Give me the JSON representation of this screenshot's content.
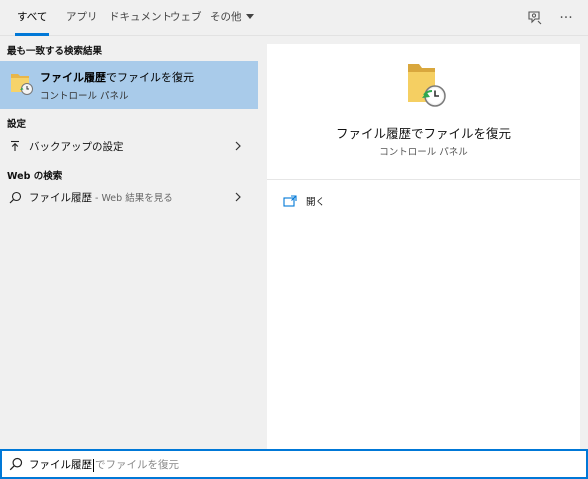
{
  "tabs": [
    {
      "label": "すべて",
      "active": true
    },
    {
      "label": "アプリ",
      "active": false
    },
    {
      "label": "ドキュメント",
      "active": false
    },
    {
      "label": "ウェブ",
      "active": false
    },
    {
      "label": "その他",
      "active": false
    }
  ],
  "topbar": {
    "feedback_icon": "feedback-icon",
    "more_icon": "more-icon",
    "more_glyph": "···"
  },
  "results": {
    "best_match_header": "最も一致する検索結果",
    "best_match": {
      "title_bold": "ファイル履歴",
      "title_rest": "でファイルを復元",
      "subtitle": "コントロール パネル",
      "icon": "file-history-folder-icon"
    },
    "settings_header": "設定",
    "settings_item": {
      "label": "バックアップの設定",
      "icon": "backup-arrow-icon"
    },
    "web_header": "Web の検索",
    "web_item": {
      "label": "ファイル履歴",
      "suffix": " - Web 結果を見る",
      "icon": "search-icon"
    }
  },
  "preview": {
    "title": "ファイル履歴でファイルを復元",
    "subtitle": "コントロール パネル",
    "actions": [
      {
        "label": "開く",
        "icon": "open-window-icon"
      }
    ]
  },
  "search": {
    "typed": "ファイル履歴",
    "suggestion": "でファイルを復元"
  },
  "colors": {
    "accent": "#0078d7",
    "selected_bg": "#a9cbea",
    "panel_bg": "#f0f0f0"
  }
}
